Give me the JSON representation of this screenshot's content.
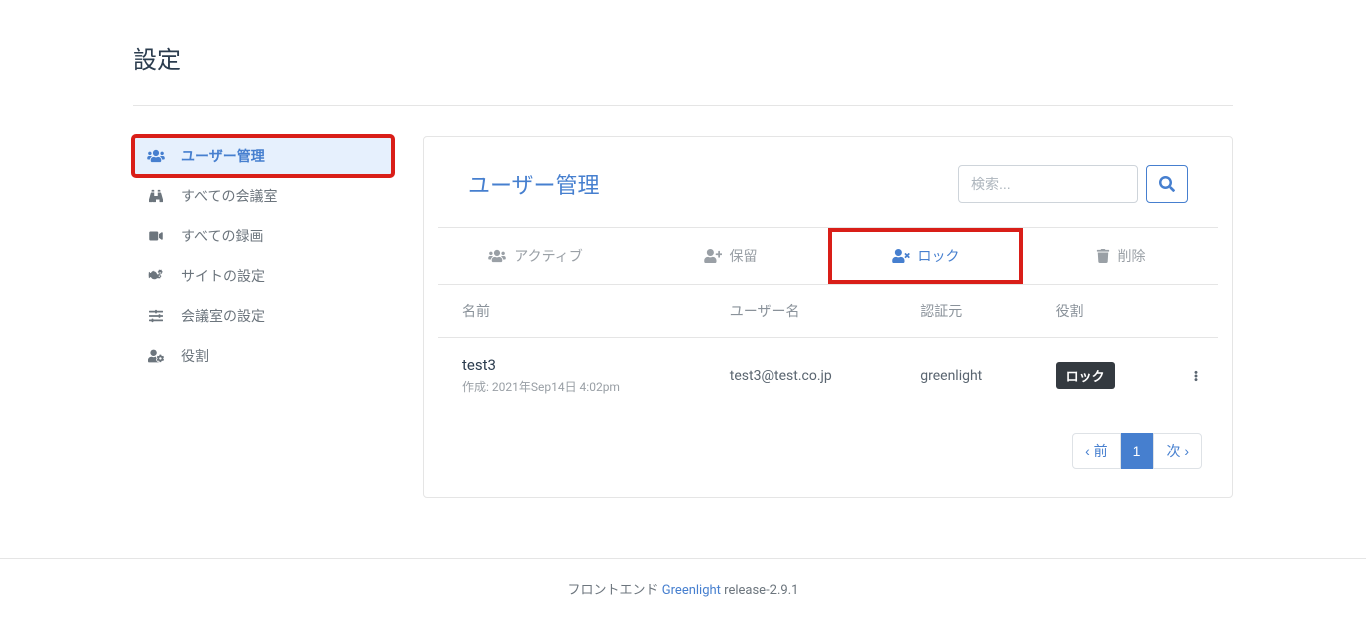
{
  "page_title": "設定",
  "sidebar": {
    "items": [
      {
        "label": "ユーザー管理",
        "icon": "users"
      },
      {
        "label": "すべての会議室",
        "icon": "binoculars"
      },
      {
        "label": "すべての録画",
        "icon": "video"
      },
      {
        "label": "サイトの設定",
        "icon": "cogs"
      },
      {
        "label": "会議室の設定",
        "icon": "sliders"
      },
      {
        "label": "役割",
        "icon": "user-cog"
      }
    ]
  },
  "main": {
    "title": "ユーザー管理",
    "search_placeholder": "検索...",
    "tabs": [
      {
        "label": "アクティブ",
        "icon": "users"
      },
      {
        "label": "保留",
        "icon": "user-plus"
      },
      {
        "label": "ロック",
        "icon": "user-times"
      },
      {
        "label": "削除",
        "icon": "trash"
      }
    ],
    "table": {
      "headers": {
        "name": "名前",
        "username": "ユーザー名",
        "provider": "認証元",
        "role": "役割"
      },
      "rows": [
        {
          "name": "test3",
          "created_prefix": "作成: ",
          "created": "2021年Sep14日 4:02pm",
          "username": "test3@test.co.jp",
          "provider": "greenlight",
          "role_badge": "ロック"
        }
      ]
    },
    "pagination": {
      "prev": "‹ 前",
      "current": "1",
      "next": "次 ›"
    }
  },
  "footer": {
    "prefix": "フロントエンド ",
    "link": "Greenlight",
    "suffix": " release-2.9.1"
  }
}
